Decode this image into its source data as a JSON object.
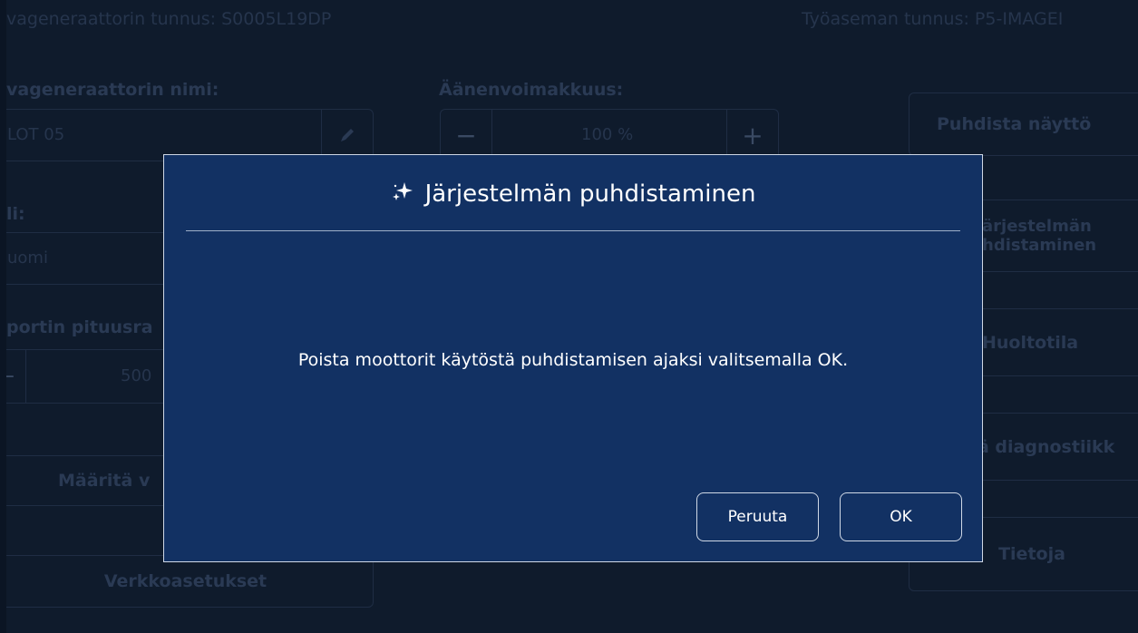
{
  "header": {
    "device_id": "vageneraattorin tunnus: S0005L19DP",
    "workstation_id": "Työaseman tunnus: P5-IMAGEI"
  },
  "settings": {
    "name_label": "vageneraattorin nimi:",
    "name_value": "LOT 05",
    "language_label": "li:",
    "language_value": "uomi",
    "length_label": "portin pituusra",
    "length_value": "500",
    "volume_label": "Äänenvoimakkuus:",
    "volume_value": "100 %",
    "define_button": "Määritä v",
    "network_button": "Verkkoasetukset"
  },
  "right_menu": {
    "clean_screen": "Puhdista näyttö",
    "system_clean_1": "ärjestelmän",
    "system_clean_2": "hdistaminen",
    "maintenance": "Huoltotila",
    "diagnostics": "ä diagnostiikk",
    "info": "Tietoja"
  },
  "dialog": {
    "title": "Järjestelmän puhdistaminen",
    "title_icon": "sparkles-icon",
    "message": "Poista moottorit käytöstä puhdistamisen ajaksi valitsemalla OK.",
    "cancel_label": "Peruuta",
    "ok_label": "OK"
  }
}
